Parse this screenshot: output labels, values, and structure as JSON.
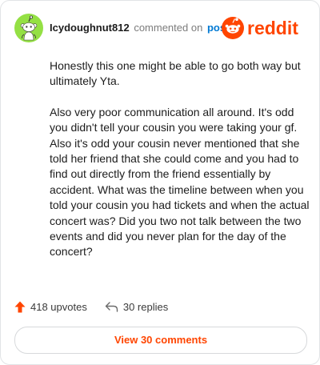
{
  "comment": {
    "username": "Icydoughnut812",
    "action_text": "commented on",
    "post_link_text": "post",
    "paragraphs": [
      "Honestly this one might be able to go both way but ultimately Yta.",
      "Also very poor communication all around. It's odd you didn't tell your cousin you were taking your gf. Also it's odd your cousin never mentioned that she told her friend that she could come and you had to find out directly from the friend essentially by accident. What was the timeline between when you told your cousin you had tickets and when the actual concert was? Did you two not talk between the two events and did you never plan for the day of the concert?"
    ]
  },
  "logo": {
    "wordmark": "reddit"
  },
  "actions": {
    "upvotes_label": "418 upvotes",
    "replies_label": "30 replies"
  },
  "footer": {
    "view_comments_label": "View 30 comments"
  },
  "icons": {
    "avatar": "snoo-avatar-icon",
    "logo": "reddit-logo-icon",
    "upvote": "upvote-arrow-icon",
    "reply": "reply-arrow-icon"
  },
  "colors": {
    "brand_orange": "#ff4500",
    "link_blue": "#0079d3",
    "avatar_green": "#94e044"
  }
}
